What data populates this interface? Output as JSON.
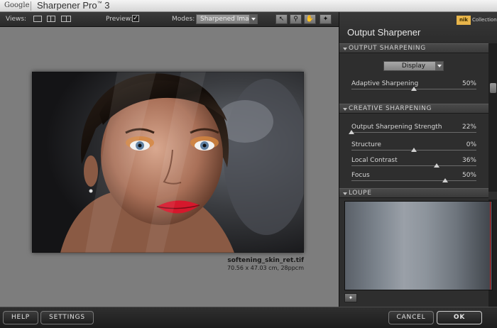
{
  "titlebar": {
    "brand": "Google",
    "app_name": "Sharpener Pro",
    "app_tm": "™",
    "app_version": "3"
  },
  "toolbar": {
    "views_label": "Views:",
    "preview_label": "Preview:",
    "preview_checked": "✓",
    "modes_label": "Modes:",
    "mode_value": "Sharpened Image"
  },
  "image": {
    "filename": "softening_skin_ret.tif",
    "filesize": "70.56 x 47.03 cm, 28ppcm"
  },
  "panel": {
    "title": "Output Sharpener",
    "brand_logo": "nik",
    "brand_collection": "Collection",
    "output_section": "OUTPUT SHARPENING",
    "output_type": "Display",
    "adaptive": {
      "label": "Adaptive Sharpening",
      "value": "50%",
      "level": 50
    },
    "creative_section": "CREATIVE SHARPENING",
    "sliders": [
      {
        "label": "Output Sharpening Strength",
        "value": "22%",
        "level": 0
      },
      {
        "label": "Structure",
        "value": "0%",
        "level": 50
      },
      {
        "label": "Local Contrast",
        "value": "36%",
        "level": 68
      },
      {
        "label": "Focus",
        "value": "50%",
        "level": 75
      }
    ],
    "loupe_section": "LOUPE"
  },
  "footer": {
    "help": "HELP",
    "settings": "SETTINGS",
    "cancel": "CANCEL",
    "ok": "OK"
  }
}
